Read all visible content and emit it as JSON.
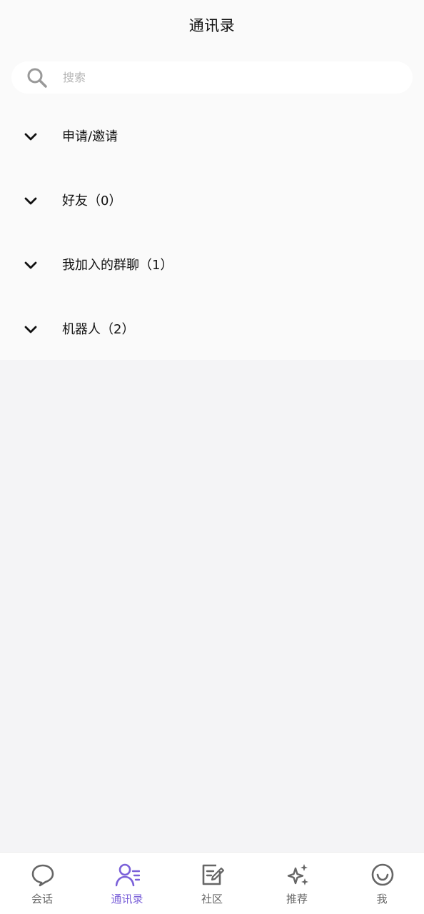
{
  "header": {
    "title": "通讯录"
  },
  "search": {
    "placeholder": "搜索",
    "value": ""
  },
  "groups": [
    {
      "label": "申请/邀请",
      "icon": "chevron-down-icon"
    },
    {
      "label": "好友（0）",
      "icon": "chevron-down-icon"
    },
    {
      "label": "我加入的群聊（1）",
      "icon": "chevron-down-icon"
    },
    {
      "label": "机器人（2）",
      "icon": "chevron-down-icon"
    }
  ],
  "tabbar": {
    "items": [
      {
        "label": "会话",
        "icon": "chat-bubble-icon",
        "active": false
      },
      {
        "label": "通讯录",
        "icon": "contacts-icon",
        "active": true
      },
      {
        "label": "社区",
        "icon": "edit-note-icon",
        "active": false
      },
      {
        "label": "推荐",
        "icon": "sparkle-icon",
        "active": false
      },
      {
        "label": "我",
        "icon": "smiley-icon",
        "active": false
      }
    ]
  },
  "colors": {
    "accent": "#7b61d9",
    "inactive_tab": "#666666",
    "content_bg": "#fafafa",
    "page_bg": "#f4f4f6"
  }
}
